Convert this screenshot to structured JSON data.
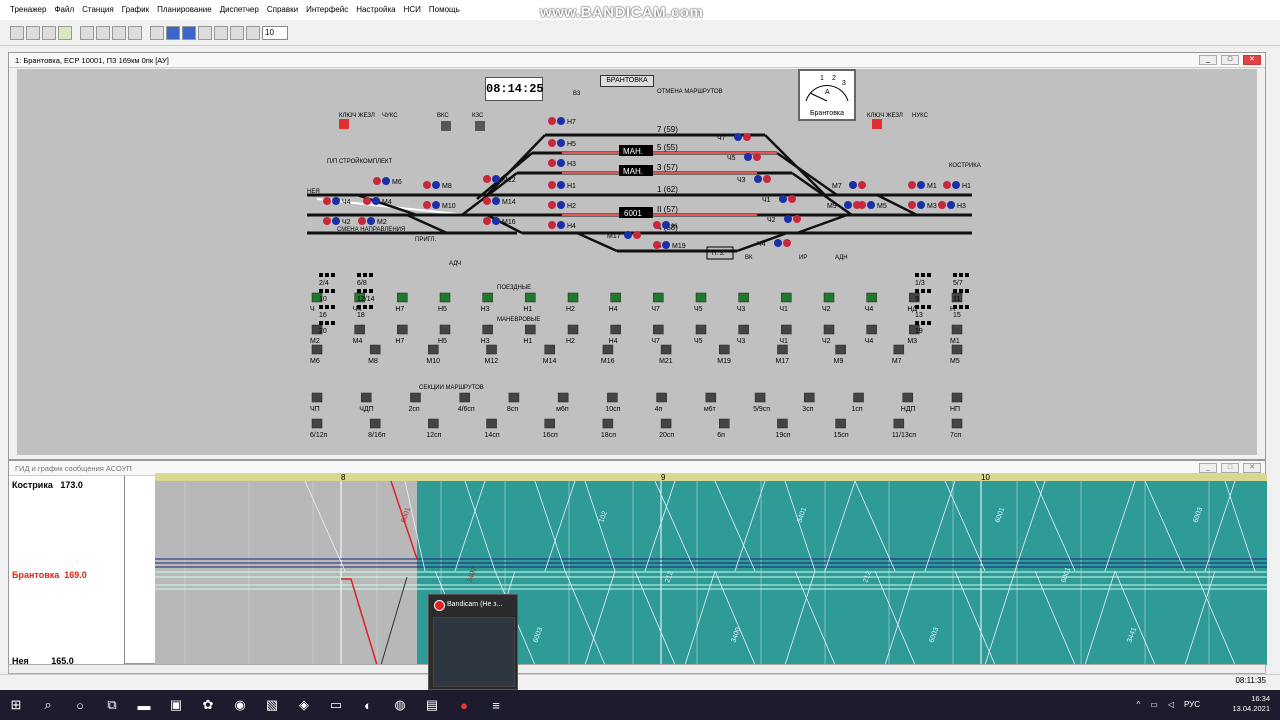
{
  "menu": [
    "Тренажер",
    "Файл",
    "Станция",
    "График",
    "Планирование",
    "Диспетчер",
    "Справки",
    "Интерфейс",
    "Настройка",
    "НСИ",
    "Помощь"
  ],
  "watermark": "www.BANDICAM.com",
  "toolbar": {
    "zoom_value": "10"
  },
  "station_window": {
    "title": "1: Брантовка, ЕСР 10001, ПЗ 169км 0пк [АУ]",
    "clock": "08:14:25",
    "station_label": "БРАНТОВКА",
    "gauge_label": "Брантовка",
    "gauge_scale": [
      "1",
      "2",
      "3"
    ],
    "gauge_unit": "А"
  },
  "tracks": [
    {
      "num": "7",
      "cap": "(59)"
    },
    {
      "num": "5",
      "cap": "(55)",
      "tag": "МАН."
    },
    {
      "num": "3",
      "cap": "(57)",
      "tag": "МАН."
    },
    {
      "num": "1",
      "cap": "(62)"
    },
    {
      "num": "II",
      "cap": "(57)",
      "train": "6001"
    },
    {
      "num": "4",
      "cap": "(58)"
    },
    {
      "num": "6",
      "cap": ""
    }
  ],
  "signals_left": [
    "Н7",
    "Н5",
    "Н3",
    "Н1",
    "Н2",
    "Н4",
    "М6",
    "М4",
    "М2",
    "Ч4",
    "Ч2",
    "Ч",
    "М8",
    "М10",
    "М12",
    "М14",
    "М16"
  ],
  "signals_right": [
    "Ч7",
    "Ч5",
    "Ч3",
    "Ч1",
    "Ч2",
    "Ч4",
    "М7",
    "М9",
    "М5",
    "М3",
    "М1",
    "Н1",
    "Н3",
    "НД",
    "Н",
    "М19",
    "М17",
    "М21"
  ],
  "station_labels": [
    "КЛЮЧ ЖЕЗЛ",
    "ЧУКС",
    "ВКС",
    "КЗС",
    "НУКС",
    "КЛЮЧ ЖЕЗЛ",
    "В3",
    "П. 3.",
    "ПРИГЛ.",
    "АДЧ",
    "АДН",
    "ВК",
    "ИР",
    "СМЕНА НАПРАВЛЕНИЯ",
    "КОСТРИКА",
    "НЕЯ",
    "П/П СТРОЙКОМПЛЕКТ",
    "ОТМЕНА МАРШРУТОВ"
  ],
  "button_rows": [
    {
      "label": "ПОЕЗДНЫЕ",
      "items": [
        "Ч",
        "Ч4",
        "Н7",
        "Н5",
        "Н3",
        "Н1",
        "Н2",
        "Н4",
        "Ч7",
        "Ч5",
        "Ч3",
        "Ч1",
        "Ч2",
        "Ч4",
        "НД",
        "Н"
      ]
    },
    {
      "label": "МАНЕВРОВЫЕ",
      "items": [
        "М2",
        "М4",
        "Н7",
        "Н5",
        "Н3",
        "Н1",
        "Н2",
        "Н4",
        "Ч7",
        "Ч5",
        "Ч3",
        "Ч1",
        "Ч2",
        "Ч4",
        "М3",
        "М1"
      ]
    },
    {
      "label": "",
      "items": [
        "М6",
        "М8",
        "М10",
        "М12",
        "М14",
        "М16",
        "М21",
        "М19",
        "М17",
        "М9",
        "М7",
        "М5"
      ]
    },
    {
      "label": "СЕКЦИИ МАРШРУТОВ",
      "items": [
        "ЧП",
        "ЧДП",
        "2сп",
        "4/6сп",
        "8сп",
        "м6п",
        "10сп",
        "4п",
        "м6т",
        "5/9сп",
        "3сп",
        "1сп",
        "НДП",
        "НП"
      ]
    },
    {
      "label": "",
      "items": [
        "6/12п",
        "8/16п",
        "12сп",
        "14сп",
        "16сп",
        "18сп",
        "20сп",
        "6п",
        "19сп",
        "15сп",
        "11/13сп",
        "7сп"
      ]
    }
  ],
  "switch_groups_left": [
    "2/4",
    "6/8",
    "10",
    "12/14",
    "16",
    "18",
    "20"
  ],
  "switch_groups_right": [
    "1/3",
    "5/7",
    "9",
    "11",
    "13",
    "15",
    "19"
  ],
  "gid_window": {
    "title": "ГИД и график сообщения АСОУП",
    "stations": [
      {
        "name": "Кострика",
        "km": "173.0"
      },
      {
        "name": "Брантовка",
        "km": "169.0"
      },
      {
        "name": "Нея",
        "km": "165.0"
      }
    ],
    "hours": [
      "8",
      "9",
      "10"
    ],
    "train_numbers": [
      "6001",
      "3402",
      "6003",
      "102",
      "212",
      "3400",
      "3401",
      "212",
      "6003",
      "6001",
      "6001",
      "3441",
      "6003"
    ]
  },
  "popup": {
    "title": "Bandicam (Не з..."
  },
  "status": {
    "time": "08:11:35"
  },
  "taskbar": {
    "lang": "РУС",
    "time": "16:34",
    "date": "13.04.2021"
  },
  "colors": {
    "station_bg": "#c0c0c0",
    "gid_teal": "#2e9b96",
    "taskbar": "#1c1c2e",
    "red": "#d21",
    "signal_red": "#c8283c",
    "signal_blue": "#1a2fa8"
  }
}
